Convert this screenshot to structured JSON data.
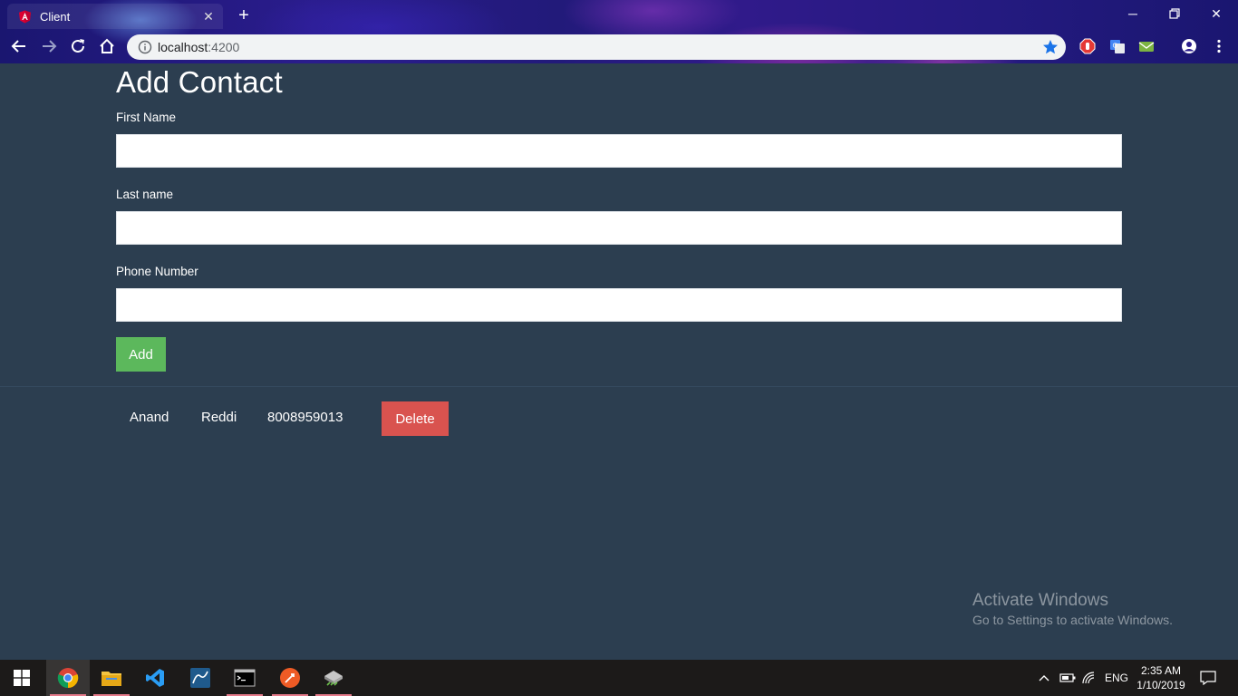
{
  "browser": {
    "tab_title": "Client",
    "url_host": "localhost",
    "url_port": ":4200"
  },
  "page": {
    "title": "Add Contact",
    "fields": {
      "first_name_label": "First Name",
      "first_name_value": "",
      "last_name_label": "Last name",
      "last_name_value": "",
      "phone_label": "Phone Number",
      "phone_value": ""
    },
    "add_button": "Add",
    "contacts": [
      {
        "first_name": "Anand",
        "last_name": "Reddi",
        "phone": "8008959013",
        "delete_label": "Delete"
      }
    ]
  },
  "watermark": {
    "title": "Activate Windows",
    "subtitle": "Go to Settings to activate Windows."
  },
  "taskbar": {
    "apps": [
      "chrome-icon",
      "file-explorer-icon",
      "vscode-icon",
      "mysql-workbench-icon",
      "terminal-icon",
      "postman-icon",
      "drive-icon"
    ],
    "language": "ENG",
    "time": "2:35 AM",
    "date": "1/10/2019"
  },
  "colors": {
    "page_bg": "#2c3e50",
    "add_button": "#5cb85c",
    "delete_button": "#d9534f"
  }
}
